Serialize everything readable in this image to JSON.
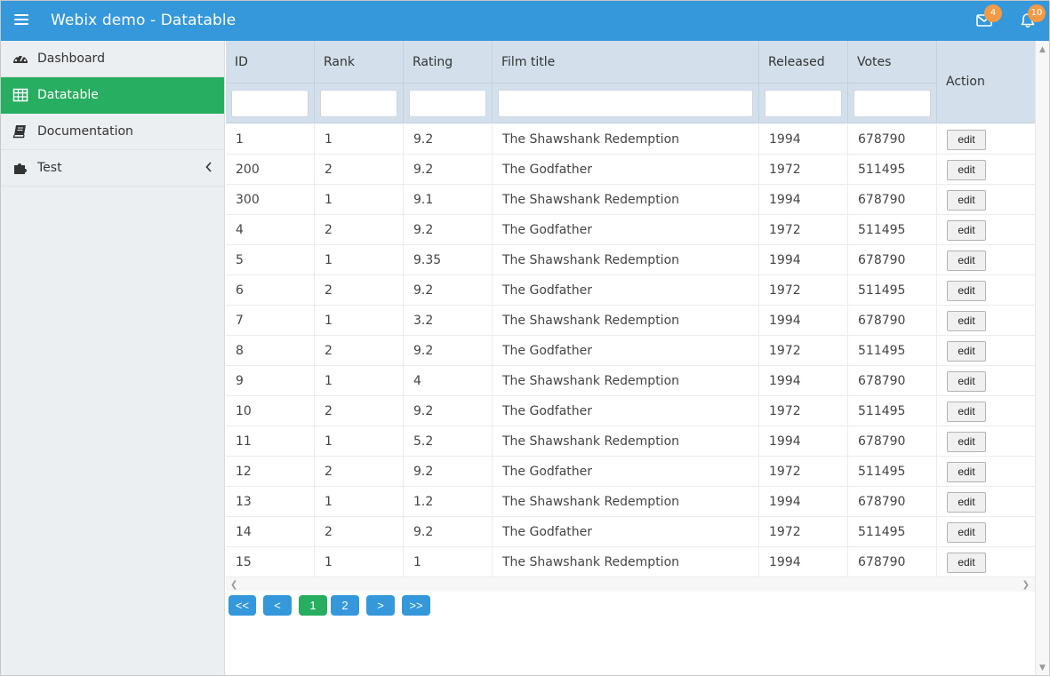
{
  "header": {
    "title": "Webix demo - Datatable",
    "mail_badge": "4",
    "bell_badge": "10"
  },
  "sidebar": {
    "items": [
      {
        "label": "Dashboard",
        "icon": "dashboard-icon"
      },
      {
        "label": "Datatable",
        "icon": "table-icon",
        "active": true
      },
      {
        "label": "Documentation",
        "icon": "book-icon"
      },
      {
        "label": "Test",
        "icon": "puzzle-icon",
        "has_submenu": true
      }
    ]
  },
  "table": {
    "columns": [
      "ID",
      "Rank",
      "Rating",
      "Film title",
      "Released",
      "Votes",
      "Action"
    ],
    "action_label": "edit",
    "rows": [
      {
        "id": "1",
        "rank": "1",
        "rating": "9.2",
        "title": "The Shawshank Redemption",
        "year": "1994",
        "votes": "678790"
      },
      {
        "id": "200",
        "rank": "2",
        "rating": "9.2",
        "title": "The Godfather",
        "year": "1972",
        "votes": "511495"
      },
      {
        "id": "300",
        "rank": "1",
        "rating": "9.1",
        "title": "The Shawshank Redemption",
        "year": "1994",
        "votes": "678790"
      },
      {
        "id": "4",
        "rank": "2",
        "rating": "9.2",
        "title": "The Godfather",
        "year": "1972",
        "votes": "511495"
      },
      {
        "id": "5",
        "rank": "1",
        "rating": "9.35",
        "title": "The Shawshank Redemption",
        "year": "1994",
        "votes": "678790"
      },
      {
        "id": "6",
        "rank": "2",
        "rating": "9.2",
        "title": "The Godfather",
        "year": "1972",
        "votes": "511495"
      },
      {
        "id": "7",
        "rank": "1",
        "rating": "3.2",
        "title": "The Shawshank Redemption",
        "year": "1994",
        "votes": "678790"
      },
      {
        "id": "8",
        "rank": "2",
        "rating": "9.2",
        "title": "The Godfather",
        "year": "1972",
        "votes": "511495"
      },
      {
        "id": "9",
        "rank": "1",
        "rating": "4",
        "title": "The Shawshank Redemption",
        "year": "1994",
        "votes": "678790"
      },
      {
        "id": "10",
        "rank": "2",
        "rating": "9.2",
        "title": "The Godfather",
        "year": "1972",
        "votes": "511495"
      },
      {
        "id": "11",
        "rank": "1",
        "rating": "5.2",
        "title": "The Shawshank Redemption",
        "year": "1994",
        "votes": "678790"
      },
      {
        "id": "12",
        "rank": "2",
        "rating": "9.2",
        "title": "The Godfather",
        "year": "1972",
        "votes": "511495"
      },
      {
        "id": "13",
        "rank": "1",
        "rating": "1.2",
        "title": "The Shawshank Redemption",
        "year": "1994",
        "votes": "678790"
      },
      {
        "id": "14",
        "rank": "2",
        "rating": "9.2",
        "title": "The Godfather",
        "year": "1972",
        "votes": "511495"
      },
      {
        "id": "15",
        "rank": "1",
        "rating": "1",
        "title": "The Shawshank Redemption",
        "year": "1994",
        "votes": "678790"
      }
    ]
  },
  "pager": {
    "first": "<<",
    "prev": "<",
    "pages": [
      "1",
      "2"
    ],
    "current": "1",
    "next": ">",
    "last": ">>"
  },
  "colors": {
    "toolbar": "#3498db",
    "active": "#27ae60",
    "badge": "#f29a46",
    "header_bg": "#d3e0ec"
  }
}
